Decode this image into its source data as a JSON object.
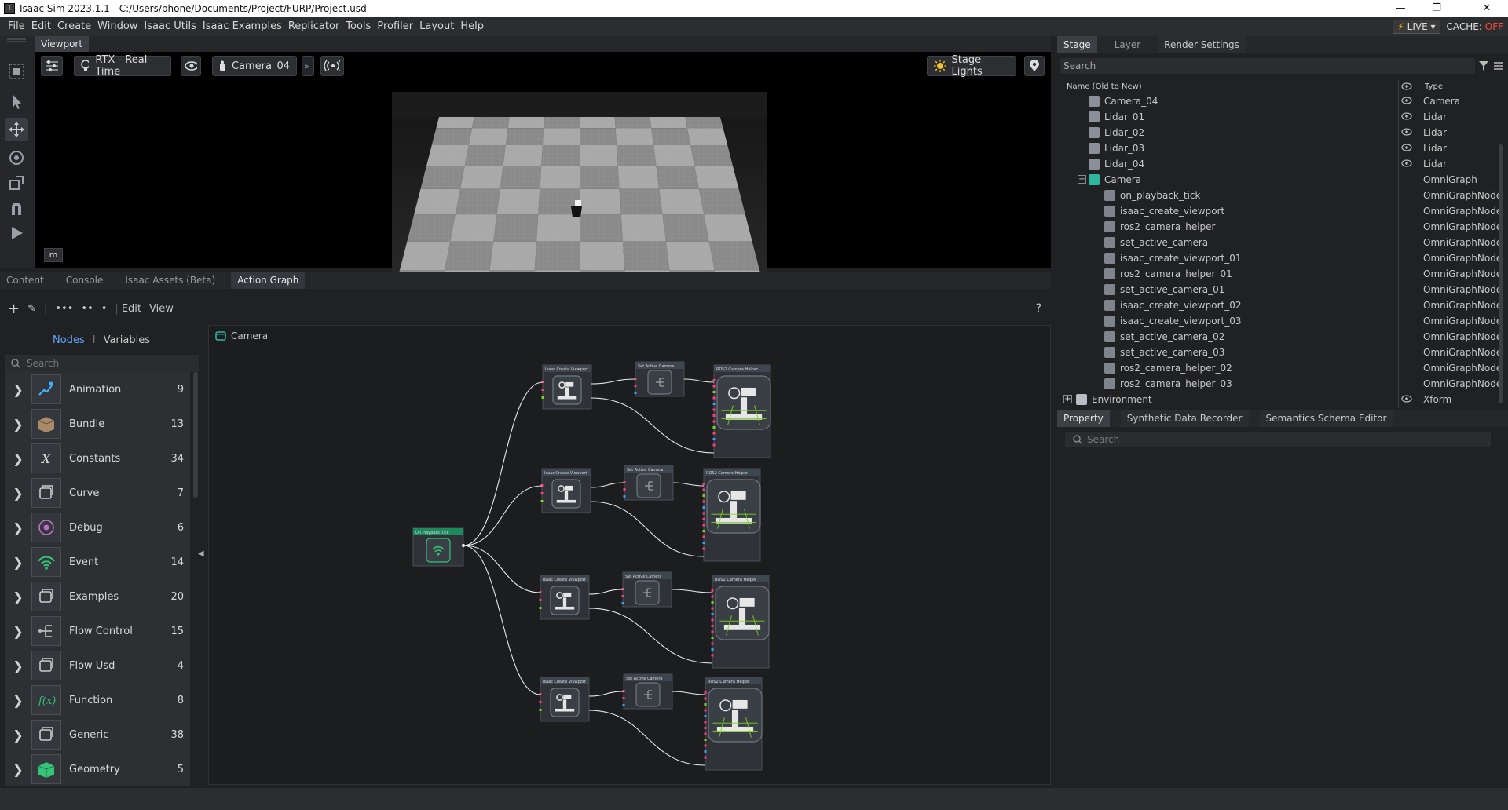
{
  "window": {
    "title": "Isaac Sim 2023.1.1 - C:/Users/phone/Documents/Project/FURP/Project.usd"
  },
  "menu": [
    "File",
    "Edit",
    "Create",
    "Window",
    "Isaac Utils",
    "Isaac Examples",
    "Replicator",
    "Tools",
    "Profiler",
    "Layout",
    "Help"
  ],
  "status": {
    "live": "LIVE",
    "cache_label": "CACHE:",
    "cache_value": "OFF"
  },
  "viewport": {
    "tab": "Viewport",
    "renderer": "RTX - Real-Time",
    "camera": "Camera_04",
    "lights": "Stage Lights",
    "unit": "m"
  },
  "bottom_tabs": [
    "Content",
    "Console",
    "Isaac Assets (Beta)",
    "Action Graph"
  ],
  "action_graph": {
    "toolbar": {
      "edit": "Edit",
      "view": "View",
      "help": "?"
    },
    "lib_tabs": {
      "nodes": "Nodes",
      "sep": "I",
      "variables": "Variables"
    },
    "search_placeholder": "Search",
    "categories": [
      {
        "label": "Animation",
        "count": "9"
      },
      {
        "label": "Bundle",
        "count": "13"
      },
      {
        "label": "Constants",
        "count": "34"
      },
      {
        "label": "Curve",
        "count": "7"
      },
      {
        "label": "Debug",
        "count": "6"
      },
      {
        "label": "Event",
        "count": "14"
      },
      {
        "label": "Examples",
        "count": "20"
      },
      {
        "label": "Flow Control",
        "count": "15"
      },
      {
        "label": "Flow Usd",
        "count": "4"
      },
      {
        "label": "Function",
        "count": "8"
      },
      {
        "label": "Generic",
        "count": "38"
      },
      {
        "label": "Geometry",
        "count": "5"
      }
    ],
    "graph_name": "Camera",
    "tick_node": "On Playback Tick",
    "rows": [
      {
        "create": "Isaac Create Viewport",
        "active": "Set Active Camera",
        "helper": "ROS2 Camera Helper"
      },
      {
        "create": "Isaac Create Viewport",
        "active": "Set Active Camera",
        "helper": "ROS2 Camera Helper"
      },
      {
        "create": "Isaac Create Viewport",
        "active": "Set Active Camera",
        "helper": "ROS2 Camera Helper"
      },
      {
        "create": "Isaac Create Viewport",
        "active": "Set Active Camera",
        "helper": "ROS2 Camera Helper"
      }
    ]
  },
  "stage": {
    "tabs": [
      "Stage",
      "Layer",
      "Render Settings"
    ],
    "search_placeholder": "Search",
    "col_name": "Name (Old to New)",
    "col_type": "Type",
    "rows": [
      {
        "name": "Camera_04",
        "type": "Camera",
        "indent": 1,
        "eye": true,
        "icon": "camera-icon"
      },
      {
        "name": "Lidar_01",
        "type": "Lidar",
        "indent": 1,
        "eye": true,
        "icon": "lidar-icon"
      },
      {
        "name": "Lidar_02",
        "type": "Lidar",
        "indent": 1,
        "eye": true,
        "icon": "lidar-icon"
      },
      {
        "name": "Lidar_03",
        "type": "Lidar",
        "indent": 1,
        "eye": true,
        "icon": "lidar-icon"
      },
      {
        "name": "Lidar_04",
        "type": "Lidar",
        "indent": 1,
        "eye": true,
        "icon": "lidar-icon"
      },
      {
        "name": "Camera",
        "type": "OmniGraph",
        "indent": 0,
        "eye": false,
        "icon": "omnigraph-icon",
        "expand": "−"
      },
      {
        "name": "on_playback_tick",
        "type": "OmniGraphNode",
        "indent": 2,
        "eye": false,
        "icon": "node-icon"
      },
      {
        "name": "isaac_create_viewport",
        "type": "OmniGraphNode",
        "indent": 2,
        "eye": false,
        "icon": "node-icon"
      },
      {
        "name": "ros2_camera_helper",
        "type": "OmniGraphNode",
        "indent": 2,
        "eye": false,
        "icon": "node-icon"
      },
      {
        "name": "set_active_camera",
        "type": "OmniGraphNode",
        "indent": 2,
        "eye": false,
        "icon": "node-icon"
      },
      {
        "name": "isaac_create_viewport_01",
        "type": "OmniGraphNode",
        "indent": 2,
        "eye": false,
        "icon": "node-icon"
      },
      {
        "name": "ros2_camera_helper_01",
        "type": "OmniGraphNode",
        "indent": 2,
        "eye": false,
        "icon": "node-icon"
      },
      {
        "name": "set_active_camera_01",
        "type": "OmniGraphNode",
        "indent": 2,
        "eye": false,
        "icon": "node-icon"
      },
      {
        "name": "isaac_create_viewport_02",
        "type": "OmniGraphNode",
        "indent": 2,
        "eye": false,
        "icon": "node-icon"
      },
      {
        "name": "isaac_create_viewport_03",
        "type": "OmniGraphNode",
        "indent": 2,
        "eye": false,
        "icon": "node-icon"
      },
      {
        "name": "set_active_camera_02",
        "type": "OmniGraphNode",
        "indent": 2,
        "eye": false,
        "icon": "node-icon"
      },
      {
        "name": "set_active_camera_03",
        "type": "OmniGraphNode",
        "indent": 2,
        "eye": false,
        "icon": "node-icon"
      },
      {
        "name": "ros2_camera_helper_02",
        "type": "OmniGraphNode",
        "indent": 2,
        "eye": false,
        "icon": "node-icon"
      },
      {
        "name": "ros2_camera_helper_03",
        "type": "OmniGraphNode",
        "indent": 2,
        "eye": false,
        "icon": "node-icon"
      },
      {
        "name": "Environment",
        "type": "Xform",
        "indent": -1,
        "eye": true,
        "icon": "xform-icon",
        "expand": "+"
      }
    ]
  },
  "property": {
    "tabs": [
      "Property",
      "Synthetic Data Recorder",
      "Semantics Schema Editor"
    ],
    "search_placeholder": "Search"
  }
}
